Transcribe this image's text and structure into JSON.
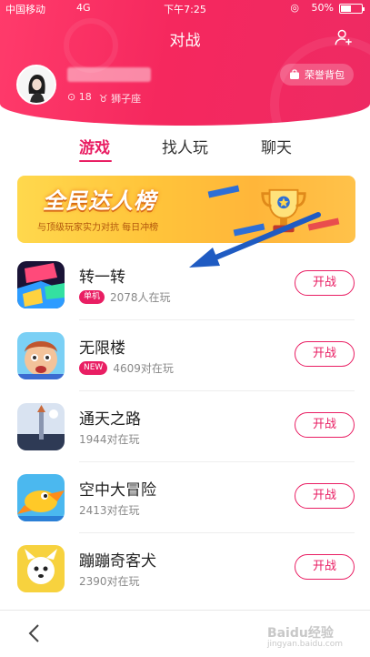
{
  "status_bar": {
    "carrier": "中国移动",
    "network": "4G",
    "time": "下午7:25",
    "battery": "50%",
    "battery_level": 0.5
  },
  "header": {
    "title": "对战",
    "honor_bag": "荣誉背包",
    "followers": "18",
    "location": "狮子座"
  },
  "tabs": [
    {
      "label": "游戏",
      "active": true
    },
    {
      "label": "找人玩",
      "active": false
    },
    {
      "label": "聊天",
      "active": false
    }
  ],
  "banner": {
    "title": "全民达人榜",
    "subtitle": "与顶级玩家实力对抗 每日冲榜"
  },
  "games": [
    {
      "name": "转一转",
      "badge": "单机",
      "players": "2078人在玩",
      "button": "开战",
      "icon": "spin-game-icon"
    },
    {
      "name": "无限楼",
      "badge": "NEW",
      "players": "4609对在玩",
      "button": "开战",
      "icon": "infinite-tower-icon"
    },
    {
      "name": "通天之路",
      "badge": "",
      "players": "1944对在玩",
      "button": "开战",
      "icon": "sky-road-icon"
    },
    {
      "name": "空中大冒险",
      "badge": "",
      "players": "2413对在玩",
      "button": "开战",
      "icon": "air-adventure-icon"
    },
    {
      "name": "蹦蹦奇客犬",
      "badge": "",
      "players": "2390对在玩",
      "button": "开战",
      "icon": "bouncing-dog-icon"
    }
  ],
  "watermark": {
    "brand": "Baidu经验",
    "url": "jingyan.baidu.com"
  },
  "colors": {
    "accent": "#e91e63",
    "header_start": "#ff3b6b",
    "header_end": "#ee2a63"
  }
}
